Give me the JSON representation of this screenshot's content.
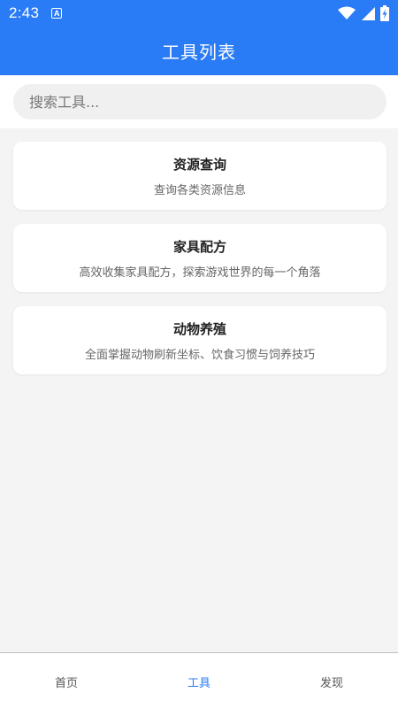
{
  "status_bar": {
    "time": "2:43",
    "notification_badge": "A",
    "icons": [
      "wifi-icon",
      "signal-icon",
      "battery-charging-icon"
    ]
  },
  "app_bar": {
    "title": "工具列表"
  },
  "search": {
    "placeholder": "搜索工具..."
  },
  "tools": [
    {
      "title": "资源查询",
      "description": "查询各类资源信息"
    },
    {
      "title": "家具配方",
      "description": "高效收集家具配方，探索游戏世界的每一个角落"
    },
    {
      "title": "动物养殖",
      "description": "全面掌握动物刷新坐标、饮食习惯与饲养技巧"
    }
  ],
  "bottom_nav": {
    "items": [
      {
        "label": "首页"
      },
      {
        "label": "工具"
      },
      {
        "label": "发现"
      }
    ],
    "active_index": 1
  },
  "colors": {
    "primary": "#2a7bf6",
    "background": "#f4f4f4",
    "card": "#ffffff"
  }
}
